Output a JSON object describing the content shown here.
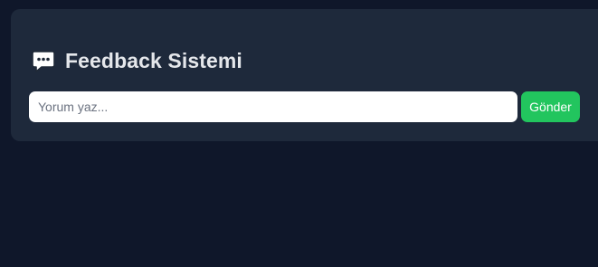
{
  "panel": {
    "title": "Feedback Sistemi",
    "title_icon": "speech-bubble-icon"
  },
  "form": {
    "comment_placeholder": "Yorum yaz...",
    "comment_value": "",
    "submit_label": "Gönder"
  },
  "colors": {
    "page_background": "#0f172a",
    "card_background": "#1e293b",
    "title_text": "#e5e7eb",
    "submit_button": "#22c55e"
  }
}
